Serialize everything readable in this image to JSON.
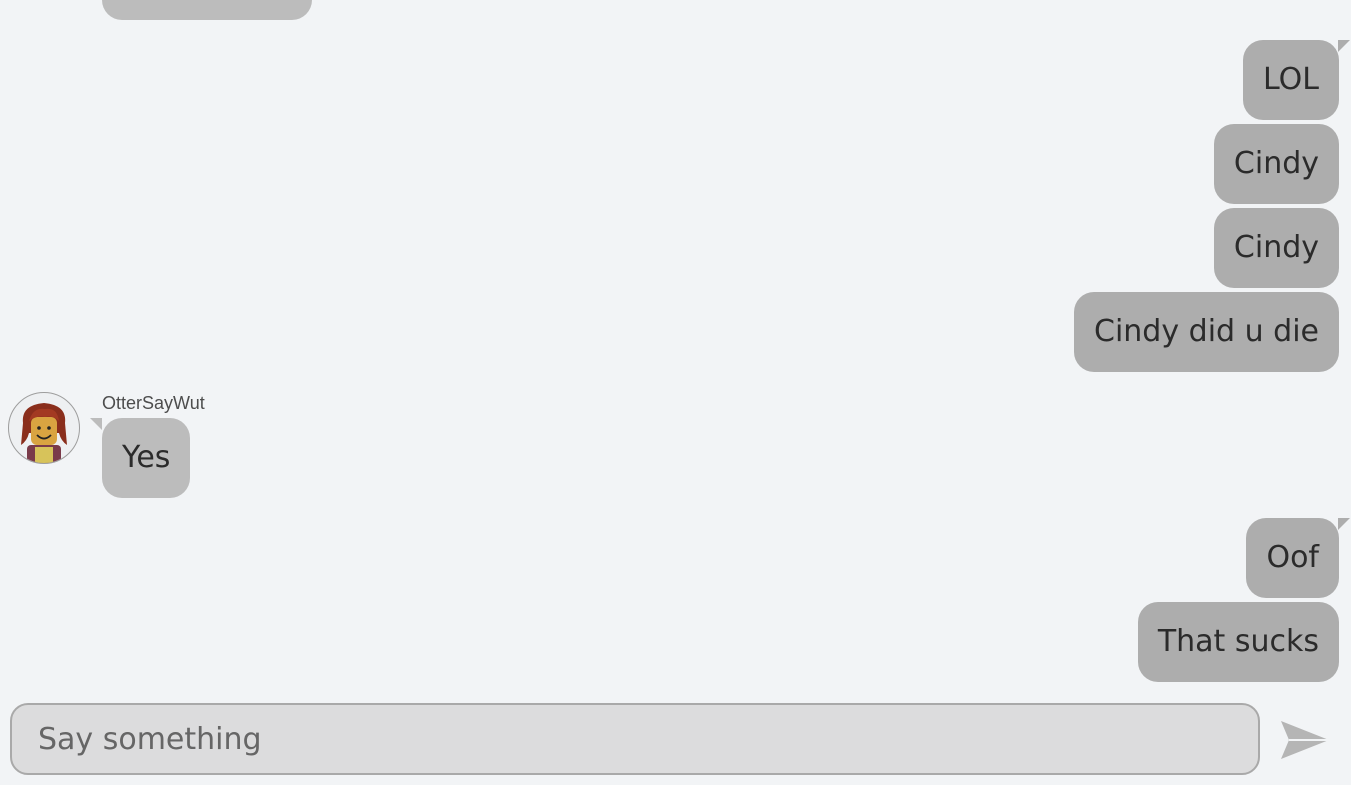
{
  "messages": [
    {
      "text": "LOL",
      "direction": "out"
    },
    {
      "text": "Cindy",
      "direction": "out"
    },
    {
      "text": "Cindy",
      "direction": "out"
    },
    {
      "text": "Cindy did u die",
      "direction": "out"
    },
    {
      "sender": "OtterSayWut",
      "text": "Yes",
      "direction": "in"
    },
    {
      "text": "Oof",
      "direction": "out"
    },
    {
      "text": "That sucks",
      "direction": "out"
    }
  ],
  "composer": {
    "placeholder": "Say something"
  },
  "icons": {
    "send": "send-arrow-icon",
    "avatar": "user-avatar"
  },
  "colors": {
    "background": "#f2f4f6",
    "outgoing_bubble": "#adadad",
    "incoming_bubble": "#bcbcbc",
    "send_icon": "#b5b5b5"
  }
}
